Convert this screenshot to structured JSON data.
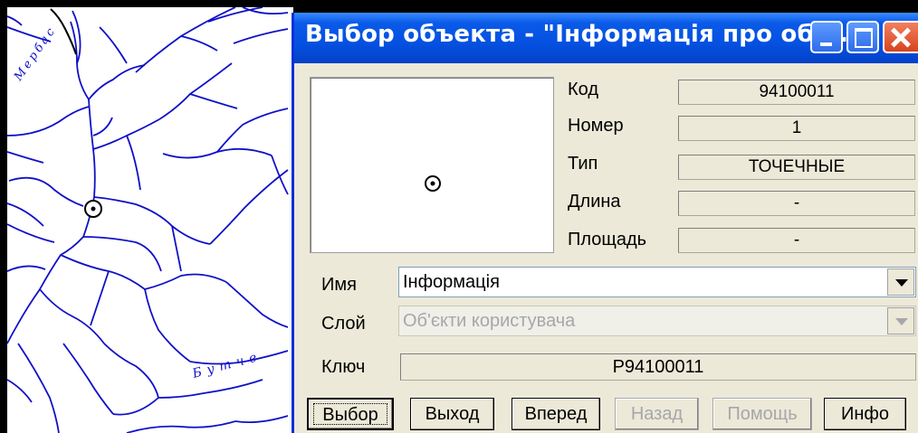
{
  "window": {
    "title": "Выбор объекта - \"Інформація про об'...",
    "controls": [
      "minimize",
      "maximize",
      "close"
    ]
  },
  "map": {
    "labels": [
      "Мербас",
      "Бутче"
    ]
  },
  "info": {
    "code_label": "Код",
    "code_value": "94100011",
    "number_label": "Номер",
    "number_value": "1",
    "type_label": "Тип",
    "type_value": "ТОЧЕЧНЫЕ",
    "length_label": "Длина",
    "length_value": "-",
    "area_label": "Площадь",
    "area_value": "-"
  },
  "form": {
    "name_label": "Имя",
    "name_value": "Інформація",
    "layer_label": "Слой",
    "layer_value": "Об'єкти користувача",
    "key_label": "Ключ",
    "key_value": "P94100011"
  },
  "buttons": {
    "select": "Выбор",
    "exit": "Выход",
    "forward": "Вперед",
    "back": "Назад",
    "help": "Помощь",
    "info": "Инфо"
  },
  "colors": {
    "river": "#1010C8",
    "titlebar": "#0551E1",
    "dialog_bg": "#ECE9D8"
  },
  "icons": {
    "point_symbol": "circle-dot-icon"
  }
}
